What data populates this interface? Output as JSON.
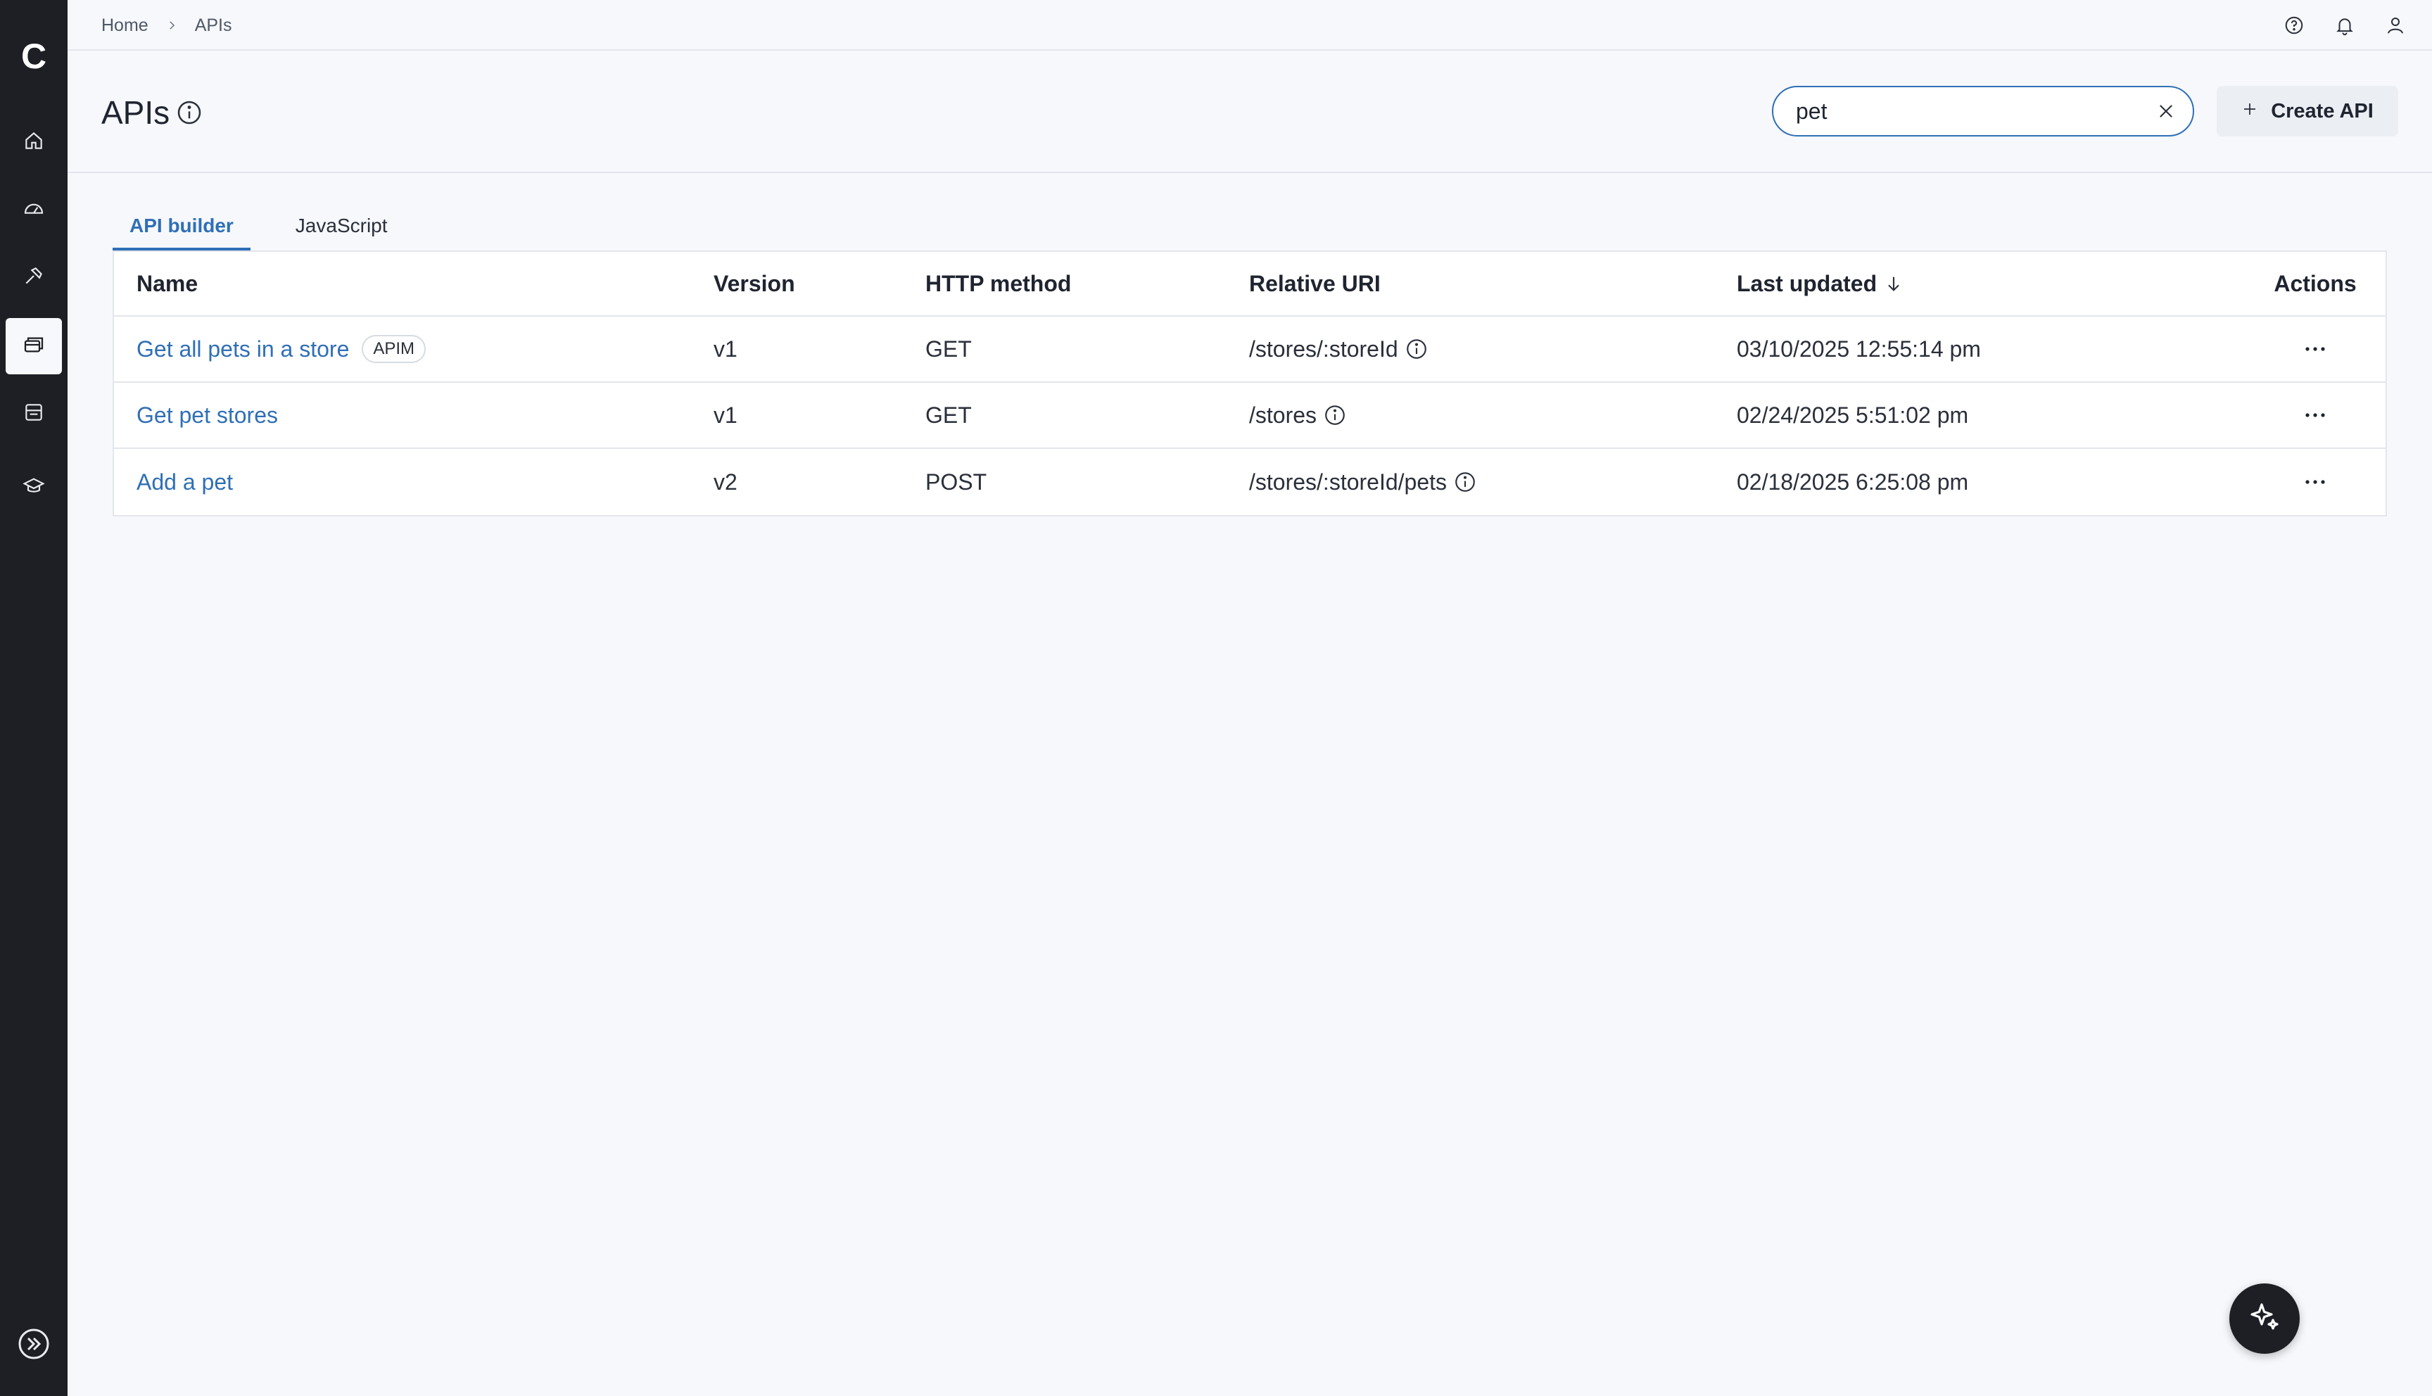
{
  "app": {
    "logo_letter": "C"
  },
  "sidebar": {
    "items": [
      {
        "icon": "home-icon"
      },
      {
        "icon": "dashboard-icon"
      },
      {
        "icon": "build-icon"
      },
      {
        "icon": "apis-icon",
        "active": true
      },
      {
        "icon": "store-icon"
      },
      {
        "icon": "learning-icon"
      }
    ],
    "expand_icon": "expand-icon"
  },
  "breadcrumb": {
    "home": "Home",
    "current": "APIs"
  },
  "topbar": {
    "icons": [
      "help-icon",
      "bell-icon",
      "user-icon"
    ]
  },
  "header": {
    "title": "APIs",
    "search_value": "pet",
    "create_label": "Create API"
  },
  "tabs": [
    {
      "label": "API builder",
      "active": true
    },
    {
      "label": "JavaScript",
      "active": false
    }
  ],
  "table": {
    "columns": {
      "name": "Name",
      "version": "Version",
      "method": "HTTP method",
      "uri": "Relative URI",
      "updated": "Last updated",
      "actions": "Actions"
    },
    "rows": [
      {
        "name": "Get all pets in a store",
        "badge": "APIM",
        "version": "v1",
        "method": "GET",
        "uri": "/stores/:storeId",
        "updated": "03/10/2025 12:55:14 pm"
      },
      {
        "name": "Get pet stores",
        "badge": "",
        "version": "v1",
        "method": "GET",
        "uri": "/stores",
        "updated": "02/24/2025 5:51:02 pm"
      },
      {
        "name": "Add a pet",
        "badge": "",
        "version": "v2",
        "method": "POST",
        "uri": "/stores/:storeId/pets",
        "updated": "02/18/2025 6:25:08 pm"
      }
    ]
  },
  "colors": {
    "accent": "#2f6fb6",
    "sidebar_bg": "#1d1f24",
    "page_bg": "#f6f8fc"
  }
}
